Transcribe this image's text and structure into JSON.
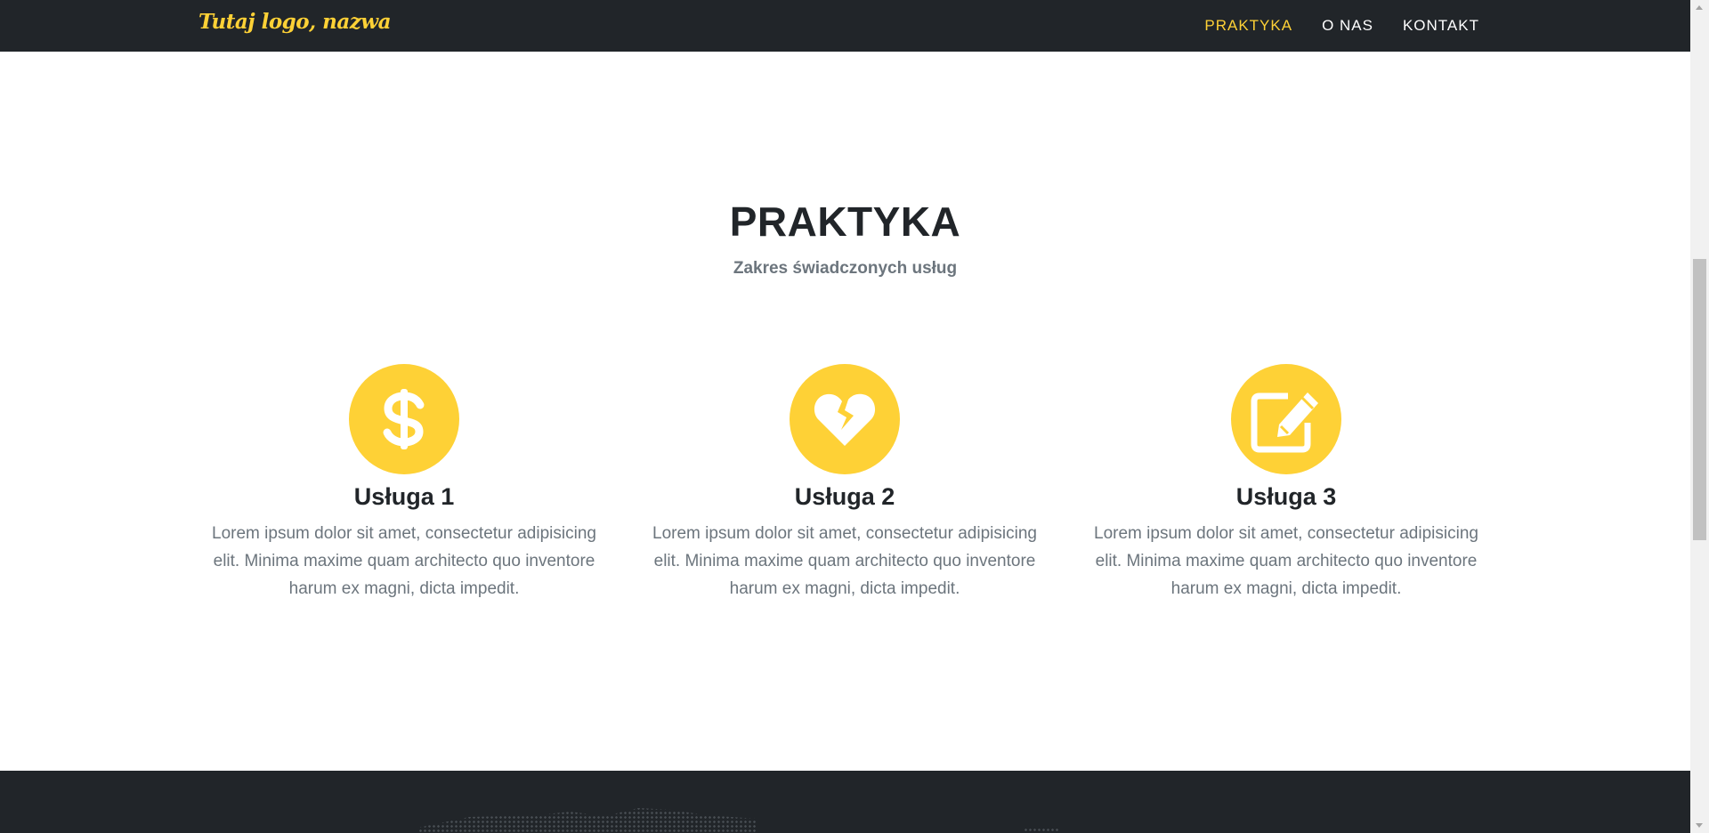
{
  "navbar": {
    "brand": "Tutaj logo, nazwa",
    "items": [
      {
        "label": "PRAKTYKA",
        "active": true
      },
      {
        "label": "O NAS",
        "active": false
      },
      {
        "label": "KONTAKT",
        "active": false
      }
    ]
  },
  "section": {
    "title": "PRAKTYKA",
    "subtitle": "Zakres świadczonych usług"
  },
  "services": [
    {
      "icon": "dollar-icon",
      "title": "Usługa 1",
      "text": "Lorem ipsum dolor sit amet, consectetur adipisicing elit. Minima maxime quam architecto quo inventore harum ex magni, dicta impedit."
    },
    {
      "icon": "broken-heart-icon",
      "title": "Usługa 2",
      "text": "Lorem ipsum dolor sit amet, consectetur adipisicing elit. Minima maxime quam architecto quo inventore harum ex magni, dicta impedit."
    },
    {
      "icon": "edit-icon",
      "title": "Usługa 3",
      "text": "Lorem ipsum dolor sit amet, consectetur adipisicing elit. Minima maxime quam architecto quo inventore harum ex magni, dicta impedit."
    }
  ],
  "colors": {
    "accent": "#fed136",
    "dark": "#212529",
    "muted": "#6c757d"
  }
}
